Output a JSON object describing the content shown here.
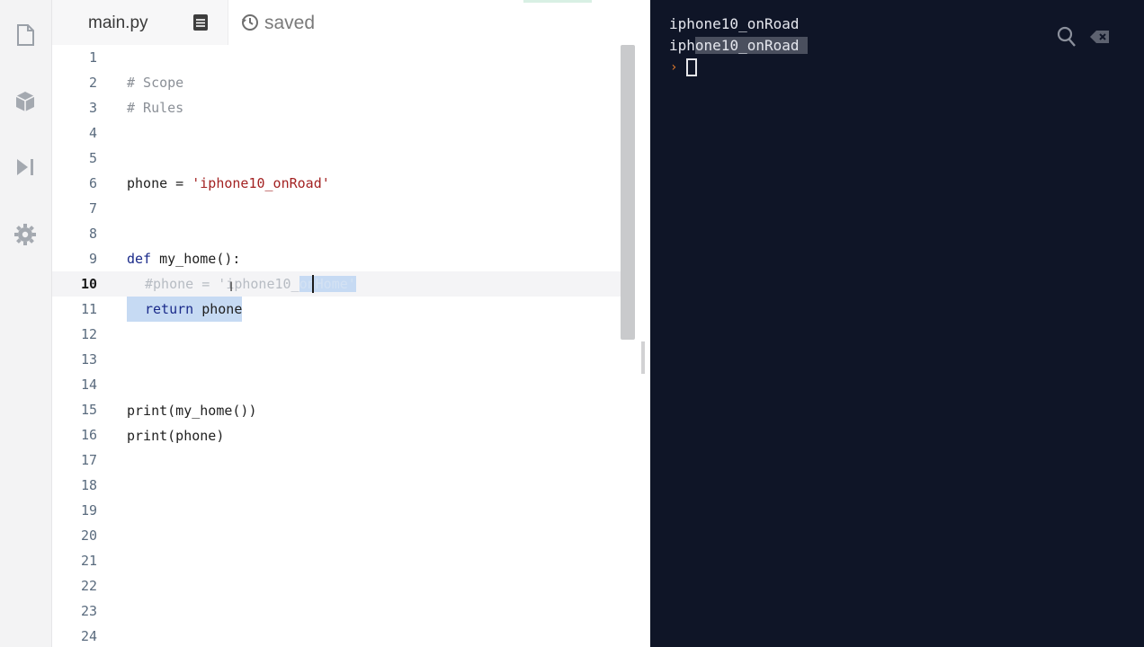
{
  "tab": {
    "filename": "main.py",
    "status": "saved"
  },
  "sidebar": {
    "icons": [
      "file-icon",
      "package-icon",
      "debugger-icon",
      "settings-icon"
    ]
  },
  "editor": {
    "active_line": 10,
    "line_numbers": [
      "1",
      "2",
      "3",
      "4",
      "5",
      "6",
      "7",
      "8",
      "9",
      "10",
      "11",
      "12",
      "13",
      "14",
      "15",
      "16",
      "17",
      "18",
      "19",
      "20",
      "21",
      "22",
      "23",
      "24"
    ],
    "code": {
      "l2": "# Scope",
      "l3": "# Rules",
      "l6_var": "phone = ",
      "l6_str": "'iphone10_onRoad'",
      "l9_kw": "def",
      "l9_rest": " my_home():",
      "l10_a": "#phone = '",
      "l10_b": "iphone10_",
      "l10_c": "onHome'",
      "l11_kw": "return",
      "l11_rest": " phone",
      "l15": "print(my_home())",
      "l16": "print(phone)"
    }
  },
  "console": {
    "output": [
      "iphone10_onRoad",
      "iphone10_onRoad"
    ],
    "prompt_symbol": "›"
  },
  "colors": {
    "console_bg": "#0f1527",
    "selection": "#c6daf3",
    "string": "#a32222",
    "keyword": "#1a2a8a",
    "prompt": "#e07a2b"
  }
}
